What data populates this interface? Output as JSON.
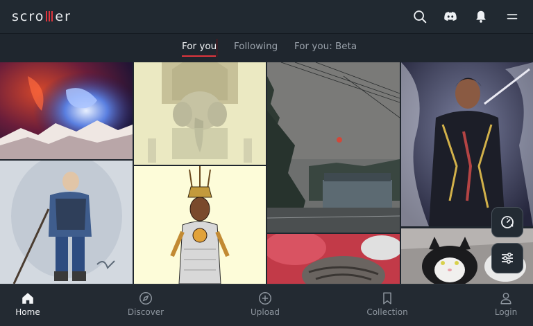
{
  "header": {
    "logo_text_left": "scro",
    "logo_text_right": "er",
    "icons": [
      "search-icon",
      "discord-icon",
      "bell-icon",
      "menu-icon"
    ]
  },
  "tabs": [
    {
      "label": "For you",
      "active": true
    },
    {
      "label": "Following",
      "active": false
    },
    {
      "label": "For you: Beta",
      "active": false
    }
  ],
  "grid": {
    "tiles": [
      "cosmic-horse-art",
      "ganesha-statue-art",
      "pine-tree-sunset-photo",
      "armored-warrior-art",
      "samurai-spearman-art",
      "aztec-warrior-art",
      "tabby-cat-photo",
      "tuxedo-cat-photo"
    ]
  },
  "floating_buttons": [
    "autoscroll-speed-icon",
    "filter-sliders-icon"
  ],
  "bottom_nav": [
    {
      "label": "Home",
      "icon": "home-icon",
      "active": true
    },
    {
      "label": "Discover",
      "icon": "compass-icon",
      "active": false
    },
    {
      "label": "Upload",
      "icon": "plus-circle-icon",
      "active": false
    },
    {
      "label": "Collection",
      "icon": "bookmark-icon",
      "active": false
    },
    {
      "label": "Login",
      "icon": "user-icon",
      "active": false
    }
  ],
  "colors": {
    "background": "#1f262e",
    "accent": "#e0353d",
    "text_active": "#f4f6f8",
    "text_muted": "#8e969f"
  }
}
